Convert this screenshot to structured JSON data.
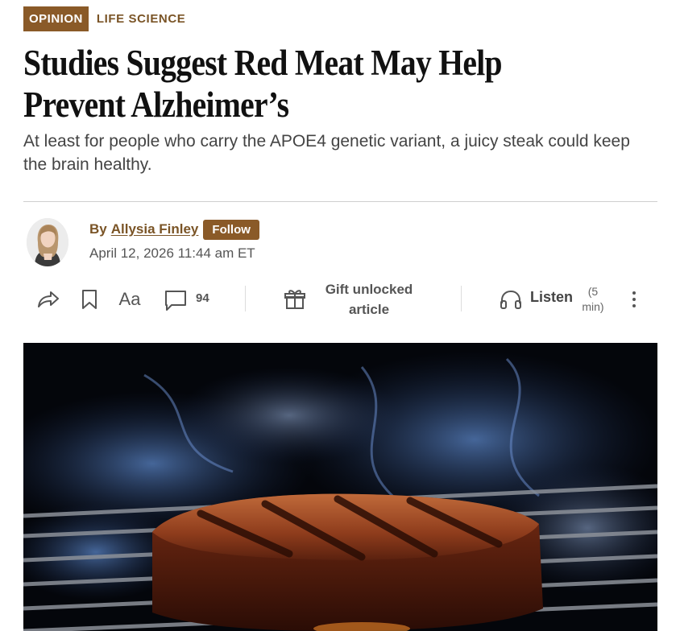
{
  "tags": {
    "category": "OPINION",
    "section": "LIFE SCIENCE"
  },
  "headline": "Studies Suggest Red Meat May Help Prevent Alzheimer’s",
  "dek": "At least for people who carry the APOE4 genetic variant, a juicy steak could keep the brain healthy.",
  "byline": {
    "prefix": "By",
    "author": "Allysia Finley",
    "follow_label": "Follow",
    "date": "April 12, 2026 11:44 am ET"
  },
  "toolbar": {
    "share_icon": "share-icon",
    "bookmark_icon": "bookmark-icon",
    "text_size_label": "Aa",
    "comment_icon": "comment-icon",
    "comment_count": "94",
    "gift_icon": "gift-icon",
    "gift_label": "Gift unlocked article",
    "listen_icon": "headphones-icon",
    "listen_label": "Listen",
    "listen_duration": "(5 min)",
    "more_icon": "more-vertical-icon"
  },
  "colors": {
    "accent": "#8a5a28",
    "accent_text": "#7a5426",
    "divider": "#cfcfcf"
  }
}
